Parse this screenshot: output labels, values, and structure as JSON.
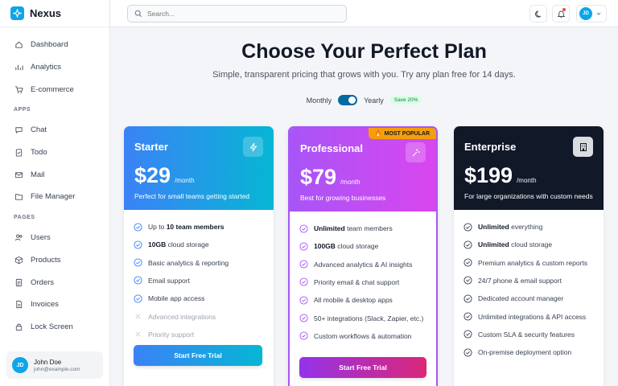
{
  "app": {
    "name": "Nexus"
  },
  "sidebar": {
    "items_main": [
      {
        "label": "Dashboard",
        "icon": "home-icon"
      },
      {
        "label": "Analytics",
        "icon": "chart-icon"
      },
      {
        "label": "E-commerce",
        "icon": "cart-icon"
      }
    ],
    "section_apps": "APPS",
    "items_apps": [
      {
        "label": "Chat",
        "icon": "chat-icon"
      },
      {
        "label": "Todo",
        "icon": "clipboard-icon"
      },
      {
        "label": "Mail",
        "icon": "mail-icon"
      },
      {
        "label": "File Manager",
        "icon": "folder-icon"
      }
    ],
    "section_pages": "PAGES",
    "items_pages": [
      {
        "label": "Users",
        "icon": "users-icon"
      },
      {
        "label": "Products",
        "icon": "box-icon"
      },
      {
        "label": "Orders",
        "icon": "orders-icon"
      },
      {
        "label": "Invoices",
        "icon": "invoice-icon"
      },
      {
        "label": "Lock Screen",
        "icon": "lock-icon"
      }
    ],
    "user": {
      "initials": "JD",
      "name": "John Doe",
      "email": "john@example.com"
    }
  },
  "topbar": {
    "search_placeholder": "Search...",
    "profile_initials": "JD"
  },
  "hero": {
    "title": "Choose Your Perfect Plan",
    "subtitle": "Simple, transparent pricing that grows with you. Try any plan free for 14 days.",
    "monthly_label": "Monthly",
    "yearly_label": "Yearly",
    "save_badge": "Save 20%"
  },
  "plans": {
    "starter": {
      "name": "Starter",
      "price": "$29",
      "period": "/month",
      "desc": "Perfect for small teams getting started",
      "cta": "Start Free Trial",
      "features": [
        {
          "pre": "Up to ",
          "bold": "10 team members",
          "post": ""
        },
        {
          "pre": "",
          "bold": "10GB",
          "post": " cloud storage"
        },
        {
          "pre": "Basic analytics & reporting",
          "bold": "",
          "post": ""
        },
        {
          "pre": "Email support",
          "bold": "",
          "post": ""
        },
        {
          "pre": "Mobile app access",
          "bold": "",
          "post": ""
        }
      ],
      "disabled": [
        "Advanced integrations",
        "Priority support"
      ]
    },
    "pro": {
      "name": "Professional",
      "price": "$79",
      "period": "/month",
      "desc": "Best for growing businesses",
      "badge": "MOST POPULAR",
      "cta": "Start Free Trial",
      "features": [
        {
          "pre": "",
          "bold": "Unlimited",
          "post": " team members"
        },
        {
          "pre": "",
          "bold": "100GB",
          "post": " cloud storage"
        },
        {
          "pre": "Advanced analytics & AI insights",
          "bold": "",
          "post": ""
        },
        {
          "pre": "Priority email & chat support",
          "bold": "",
          "post": ""
        },
        {
          "pre": "All mobile & desktop apps",
          "bold": "",
          "post": ""
        },
        {
          "pre": "50+ integrations (Slack, Zapier, etc.)",
          "bold": "",
          "post": ""
        },
        {
          "pre": "Custom workflows & automation",
          "bold": "",
          "post": ""
        }
      ]
    },
    "enterprise": {
      "name": "Enterprise",
      "price": "$199",
      "period": "/month",
      "desc": "For large organizations with custom needs",
      "features": [
        {
          "pre": "",
          "bold": "Unlimited",
          "post": " everything"
        },
        {
          "pre": "",
          "bold": "Unlimited",
          "post": " cloud storage"
        },
        {
          "pre": "Premium analytics & custom reports",
          "bold": "",
          "post": ""
        },
        {
          "pre": "24/7 phone & email support",
          "bold": "",
          "post": ""
        },
        {
          "pre": "Dedicated account manager",
          "bold": "",
          "post": ""
        },
        {
          "pre": "Unlimited integrations & API access",
          "bold": "",
          "post": ""
        },
        {
          "pre": "Custom SLA & security features",
          "bold": "",
          "post": ""
        },
        {
          "pre": "On-premise deployment option",
          "bold": "",
          "post": ""
        }
      ]
    }
  },
  "colors": {
    "accent": "#0ea5e9",
    "starter": "#3b82f6",
    "pro": "#a855f7",
    "enterprise": "#111827"
  }
}
